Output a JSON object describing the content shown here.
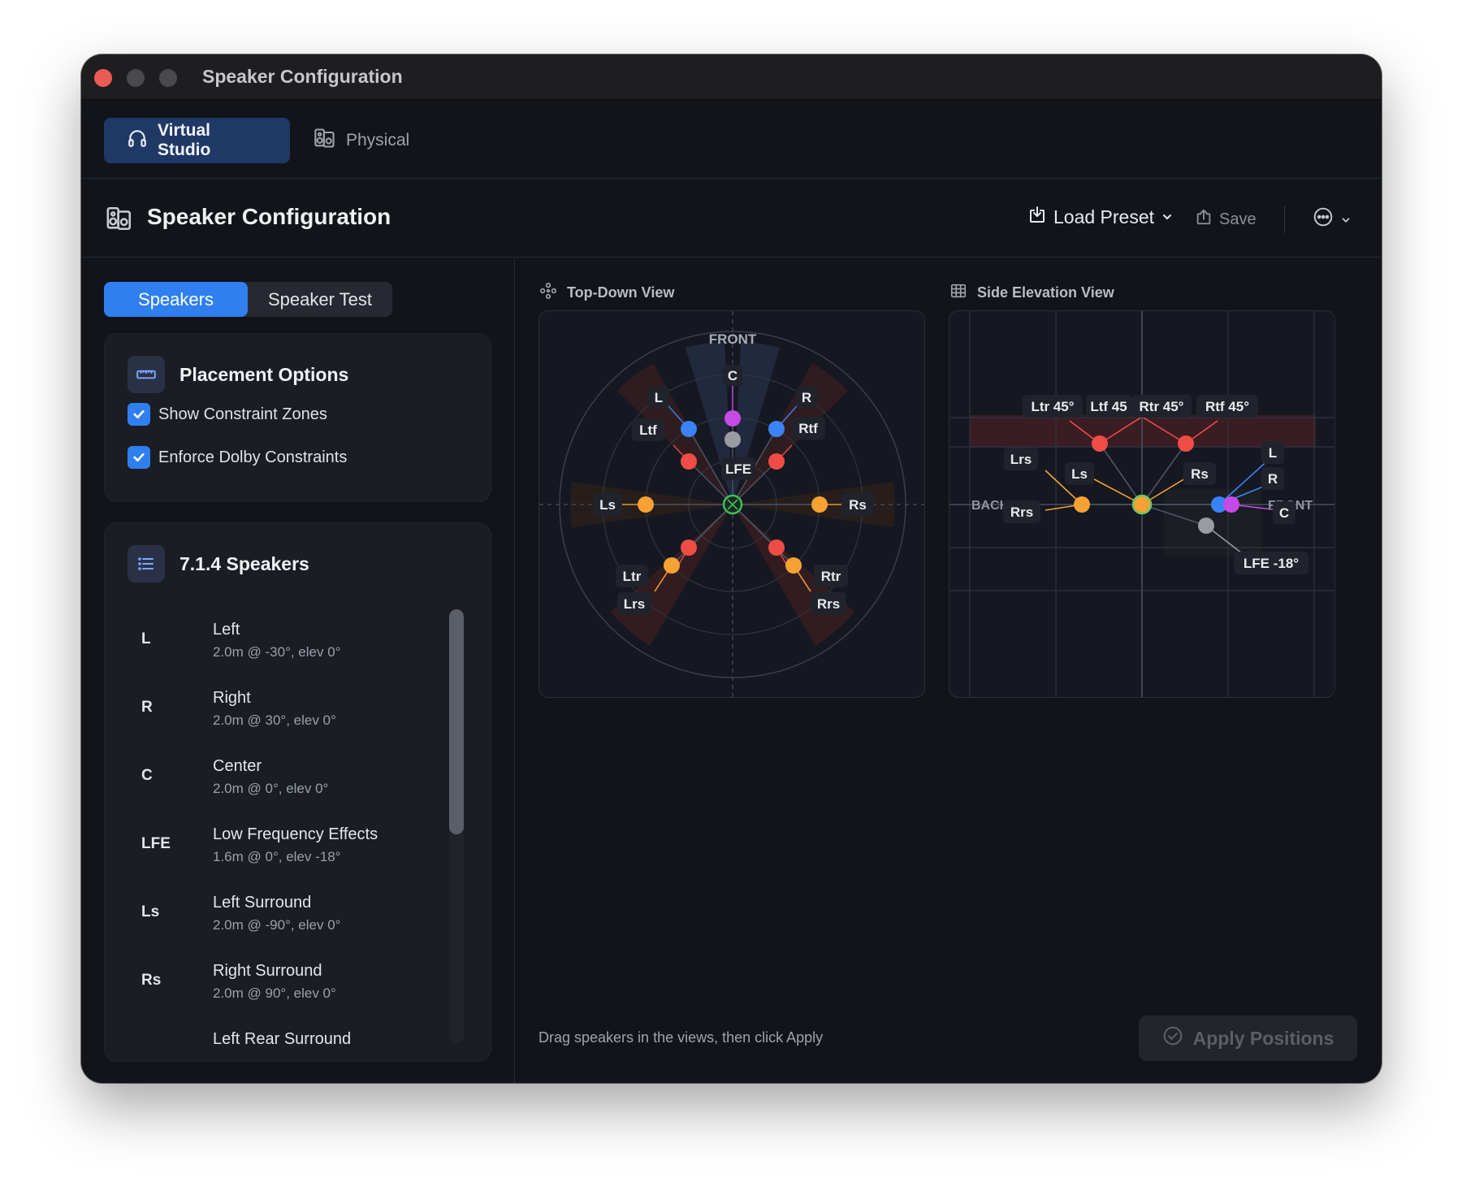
{
  "window": {
    "title": "Speaker Configuration"
  },
  "modes": [
    {
      "label": "Virtual Studio",
      "icon": "headphones-icon",
      "active": true
    },
    {
      "label": "Physical",
      "icon": "speaker-icon",
      "active": false
    }
  ],
  "header": {
    "title": "Speaker Configuration",
    "load_preset": "Load Preset",
    "save": "Save"
  },
  "tabs": {
    "speakers": "Speakers",
    "speaker_test": "Speaker Test"
  },
  "placement": {
    "title": "Placement Options",
    "options": [
      {
        "label": "Show Constraint Zones",
        "checked": true
      },
      {
        "label": "Enforce Dolby Constraints",
        "checked": true
      }
    ]
  },
  "speaker_list": {
    "title": "7.1.4 Speakers",
    "items": [
      {
        "code": "L",
        "name": "Left",
        "detail": "2.0m @ -30°, elev 0°"
      },
      {
        "code": "R",
        "name": "Right",
        "detail": "2.0m @ 30°, elev 0°"
      },
      {
        "code": "C",
        "name": "Center",
        "detail": "2.0m @ 0°, elev 0°"
      },
      {
        "code": "LFE",
        "name": "Low Frequency Effects",
        "detail": "1.6m @ 0°, elev -18°"
      },
      {
        "code": "Ls",
        "name": "Left Surround",
        "detail": "2.0m @ -90°, elev 0°"
      },
      {
        "code": "Rs",
        "name": "Right Surround",
        "detail": "2.0m @ 90°, elev 0°"
      },
      {
        "code": "",
        "name": "Left Rear Surround",
        "detail": ""
      }
    ]
  },
  "top_view": {
    "label": "Top-Down View",
    "front_label": "FRONT",
    "speakers": {
      "C": "C",
      "L": "L",
      "R": "R",
      "Ltf": "Ltf",
      "Rtf": "Rtf",
      "LFE": "LFE",
      "Ls": "Ls",
      "Rs": "Rs",
      "Ltr": "Ltr",
      "Rtr": "Rtr",
      "Lrs": "Lrs",
      "Rrs": "Rrs"
    }
  },
  "side_view": {
    "label": "Side Elevation View",
    "back_label": "BACK",
    "front_label": "FRONT",
    "tags": {
      "ltr": "Ltr 45°",
      "ltf": "Ltf 45",
      "rtr": "Rtr 45°",
      "rtf": "Rtf 45°",
      "lrs": "Lrs",
      "ls": "Ls",
      "rs": "Rs",
      "rrs": "Rrs",
      "l": "L",
      "r": "R",
      "c": "C",
      "lfe": "LFE -18°"
    }
  },
  "footer": {
    "hint": "Drag speakers in the views, then click Apply",
    "apply": "Apply Positions"
  },
  "colors": {
    "accent": "#2f7ff0",
    "front_speakers": "#3b82f6",
    "center": "#c54ae6",
    "lfe": "#9a9ca2",
    "height_speakers": "#ef4c45",
    "surround": "#f5a133",
    "listener": "#3fbf5a"
  }
}
